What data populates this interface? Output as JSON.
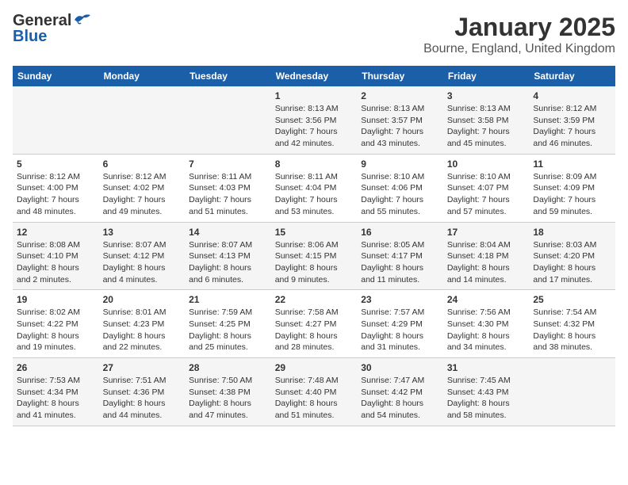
{
  "logo": {
    "general": "General",
    "blue": "Blue"
  },
  "title": "January 2025",
  "subtitle": "Bourne, England, United Kingdom",
  "headers": [
    "Sunday",
    "Monday",
    "Tuesday",
    "Wednesday",
    "Thursday",
    "Friday",
    "Saturday"
  ],
  "weeks": [
    [
      {
        "day": "",
        "sunrise": "",
        "sunset": "",
        "daylight": ""
      },
      {
        "day": "",
        "sunrise": "",
        "sunset": "",
        "daylight": ""
      },
      {
        "day": "",
        "sunrise": "",
        "sunset": "",
        "daylight": ""
      },
      {
        "day": "1",
        "sunrise": "Sunrise: 8:13 AM",
        "sunset": "Sunset: 3:56 PM",
        "daylight": "Daylight: 7 hours and 42 minutes."
      },
      {
        "day": "2",
        "sunrise": "Sunrise: 8:13 AM",
        "sunset": "Sunset: 3:57 PM",
        "daylight": "Daylight: 7 hours and 43 minutes."
      },
      {
        "day": "3",
        "sunrise": "Sunrise: 8:13 AM",
        "sunset": "Sunset: 3:58 PM",
        "daylight": "Daylight: 7 hours and 45 minutes."
      },
      {
        "day": "4",
        "sunrise": "Sunrise: 8:12 AM",
        "sunset": "Sunset: 3:59 PM",
        "daylight": "Daylight: 7 hours and 46 minutes."
      }
    ],
    [
      {
        "day": "5",
        "sunrise": "Sunrise: 8:12 AM",
        "sunset": "Sunset: 4:00 PM",
        "daylight": "Daylight: 7 hours and 48 minutes."
      },
      {
        "day": "6",
        "sunrise": "Sunrise: 8:12 AM",
        "sunset": "Sunset: 4:02 PM",
        "daylight": "Daylight: 7 hours and 49 minutes."
      },
      {
        "day": "7",
        "sunrise": "Sunrise: 8:11 AM",
        "sunset": "Sunset: 4:03 PM",
        "daylight": "Daylight: 7 hours and 51 minutes."
      },
      {
        "day": "8",
        "sunrise": "Sunrise: 8:11 AM",
        "sunset": "Sunset: 4:04 PM",
        "daylight": "Daylight: 7 hours and 53 minutes."
      },
      {
        "day": "9",
        "sunrise": "Sunrise: 8:10 AM",
        "sunset": "Sunset: 4:06 PM",
        "daylight": "Daylight: 7 hours and 55 minutes."
      },
      {
        "day": "10",
        "sunrise": "Sunrise: 8:10 AM",
        "sunset": "Sunset: 4:07 PM",
        "daylight": "Daylight: 7 hours and 57 minutes."
      },
      {
        "day": "11",
        "sunrise": "Sunrise: 8:09 AM",
        "sunset": "Sunset: 4:09 PM",
        "daylight": "Daylight: 7 hours and 59 minutes."
      }
    ],
    [
      {
        "day": "12",
        "sunrise": "Sunrise: 8:08 AM",
        "sunset": "Sunset: 4:10 PM",
        "daylight": "Daylight: 8 hours and 2 minutes."
      },
      {
        "day": "13",
        "sunrise": "Sunrise: 8:07 AM",
        "sunset": "Sunset: 4:12 PM",
        "daylight": "Daylight: 8 hours and 4 minutes."
      },
      {
        "day": "14",
        "sunrise": "Sunrise: 8:07 AM",
        "sunset": "Sunset: 4:13 PM",
        "daylight": "Daylight: 8 hours and 6 minutes."
      },
      {
        "day": "15",
        "sunrise": "Sunrise: 8:06 AM",
        "sunset": "Sunset: 4:15 PM",
        "daylight": "Daylight: 8 hours and 9 minutes."
      },
      {
        "day": "16",
        "sunrise": "Sunrise: 8:05 AM",
        "sunset": "Sunset: 4:17 PM",
        "daylight": "Daylight: 8 hours and 11 minutes."
      },
      {
        "day": "17",
        "sunrise": "Sunrise: 8:04 AM",
        "sunset": "Sunset: 4:18 PM",
        "daylight": "Daylight: 8 hours and 14 minutes."
      },
      {
        "day": "18",
        "sunrise": "Sunrise: 8:03 AM",
        "sunset": "Sunset: 4:20 PM",
        "daylight": "Daylight: 8 hours and 17 minutes."
      }
    ],
    [
      {
        "day": "19",
        "sunrise": "Sunrise: 8:02 AM",
        "sunset": "Sunset: 4:22 PM",
        "daylight": "Daylight: 8 hours and 19 minutes."
      },
      {
        "day": "20",
        "sunrise": "Sunrise: 8:01 AM",
        "sunset": "Sunset: 4:23 PM",
        "daylight": "Daylight: 8 hours and 22 minutes."
      },
      {
        "day": "21",
        "sunrise": "Sunrise: 7:59 AM",
        "sunset": "Sunset: 4:25 PM",
        "daylight": "Daylight: 8 hours and 25 minutes."
      },
      {
        "day": "22",
        "sunrise": "Sunrise: 7:58 AM",
        "sunset": "Sunset: 4:27 PM",
        "daylight": "Daylight: 8 hours and 28 minutes."
      },
      {
        "day": "23",
        "sunrise": "Sunrise: 7:57 AM",
        "sunset": "Sunset: 4:29 PM",
        "daylight": "Daylight: 8 hours and 31 minutes."
      },
      {
        "day": "24",
        "sunrise": "Sunrise: 7:56 AM",
        "sunset": "Sunset: 4:30 PM",
        "daylight": "Daylight: 8 hours and 34 minutes."
      },
      {
        "day": "25",
        "sunrise": "Sunrise: 7:54 AM",
        "sunset": "Sunset: 4:32 PM",
        "daylight": "Daylight: 8 hours and 38 minutes."
      }
    ],
    [
      {
        "day": "26",
        "sunrise": "Sunrise: 7:53 AM",
        "sunset": "Sunset: 4:34 PM",
        "daylight": "Daylight: 8 hours and 41 minutes."
      },
      {
        "day": "27",
        "sunrise": "Sunrise: 7:51 AM",
        "sunset": "Sunset: 4:36 PM",
        "daylight": "Daylight: 8 hours and 44 minutes."
      },
      {
        "day": "28",
        "sunrise": "Sunrise: 7:50 AM",
        "sunset": "Sunset: 4:38 PM",
        "daylight": "Daylight: 8 hours and 47 minutes."
      },
      {
        "day": "29",
        "sunrise": "Sunrise: 7:48 AM",
        "sunset": "Sunset: 4:40 PM",
        "daylight": "Daylight: 8 hours and 51 minutes."
      },
      {
        "day": "30",
        "sunrise": "Sunrise: 7:47 AM",
        "sunset": "Sunset: 4:42 PM",
        "daylight": "Daylight: 8 hours and 54 minutes."
      },
      {
        "day": "31",
        "sunrise": "Sunrise: 7:45 AM",
        "sunset": "Sunset: 4:43 PM",
        "daylight": "Daylight: 8 hours and 58 minutes."
      },
      {
        "day": "",
        "sunrise": "",
        "sunset": "",
        "daylight": ""
      }
    ]
  ]
}
